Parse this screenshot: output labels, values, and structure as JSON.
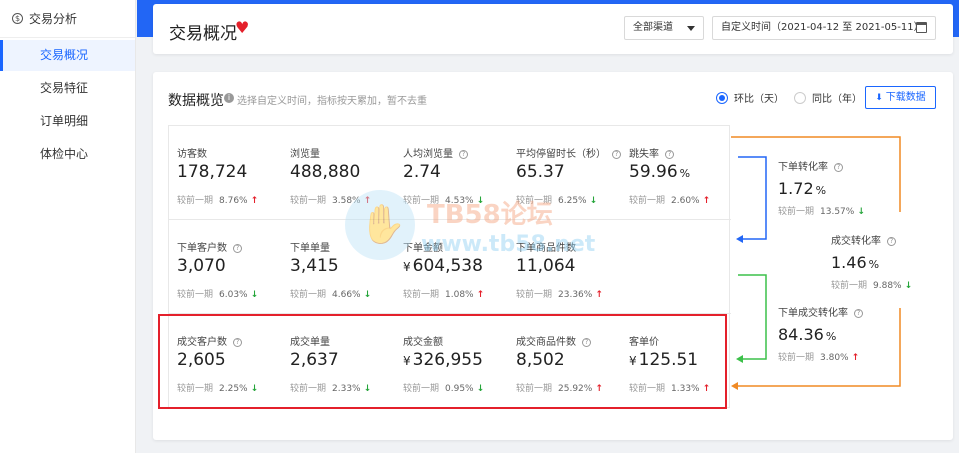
{
  "sidebar": {
    "header": "交易分析",
    "items": [
      {
        "label": "交易概况",
        "active": true
      },
      {
        "label": "交易特征",
        "active": false
      },
      {
        "label": "订单明细",
        "active": false
      },
      {
        "label": "体检中心",
        "active": false
      }
    ]
  },
  "header": {
    "title": "交易概况",
    "channel": "全部渠道",
    "date_range": "自定义时间（2021-04-12 至 2021-05-11）"
  },
  "overview": {
    "title": "数据概览",
    "hint": "选择自定义时间，指标按天累加，暂不去重",
    "radio_1": "环比（天）",
    "radio_2": "同比（年）",
    "download": "下载数据",
    "compare_label": "较前一期"
  },
  "metrics": {
    "visitors": {
      "label": "访客数",
      "value": "178,724",
      "change": "8.76%",
      "dir": "up"
    },
    "pageviews": {
      "label": "浏览量",
      "value": "488,880",
      "change": "3.58%",
      "dir": "up"
    },
    "avg_views": {
      "label": "人均浏览量",
      "value": "2.74",
      "change": "4.53%",
      "dir": "down"
    },
    "avg_stay": {
      "label": "平均停留时长（秒）",
      "value": "65.37",
      "change": "6.25%",
      "dir": "down"
    },
    "bounce": {
      "label": "跳失率",
      "value": "59.96",
      "unit": "%",
      "change": "2.60%",
      "dir": "up"
    },
    "order_customers": {
      "label": "下单客户数",
      "value": "3,070",
      "change": "6.03%",
      "dir": "down"
    },
    "order_count": {
      "label": "下单单量",
      "value": "3,415",
      "change": "4.66%",
      "dir": "down"
    },
    "order_amount": {
      "label": "下单金额",
      "currency": "¥",
      "value": "604,538",
      "change": "1.08%",
      "dir": "up"
    },
    "order_items": {
      "label": "下单商品件数",
      "value": "11,064",
      "change": "23.36%",
      "dir": "up"
    },
    "deal_customers": {
      "label": "成交客户数",
      "value": "2,605",
      "change": "2.25%",
      "dir": "down"
    },
    "deal_count": {
      "label": "成交单量",
      "value": "2,637",
      "change": "2.33%",
      "dir": "down"
    },
    "deal_amount": {
      "label": "成交金额",
      "currency": "¥",
      "value": "326,955",
      "change": "0.95%",
      "dir": "down"
    },
    "deal_items": {
      "label": "成交商品件数",
      "value": "8,502",
      "change": "25.92%",
      "dir": "up"
    },
    "avg_order_value": {
      "label": "客单价",
      "currency": "¥",
      "value": "125.51",
      "change": "1.33%",
      "dir": "up"
    }
  },
  "funnel": {
    "order_conversion": {
      "label": "下单转化率",
      "value": "1.72",
      "unit": "%",
      "change": "13.57%",
      "dir": "down"
    },
    "deal_conversion": {
      "label": "成交转化率",
      "value": "1.46",
      "unit": "%",
      "change": "9.88%",
      "dir": "down"
    },
    "order_deal_conversion": {
      "label": "下单成交转化率",
      "value": "84.36",
      "unit": "%",
      "change": "3.80%",
      "dir": "up"
    }
  },
  "watermark": {
    "line1": "TB58论坛",
    "line2": "www.tb58.net"
  },
  "colors": {
    "accent": "#2266f5",
    "up": "#e4202b",
    "down": "#25a53a",
    "flow_orange": "#f08a24",
    "flow_green": "#3cc04a",
    "flow_blue": "#2266f5"
  }
}
